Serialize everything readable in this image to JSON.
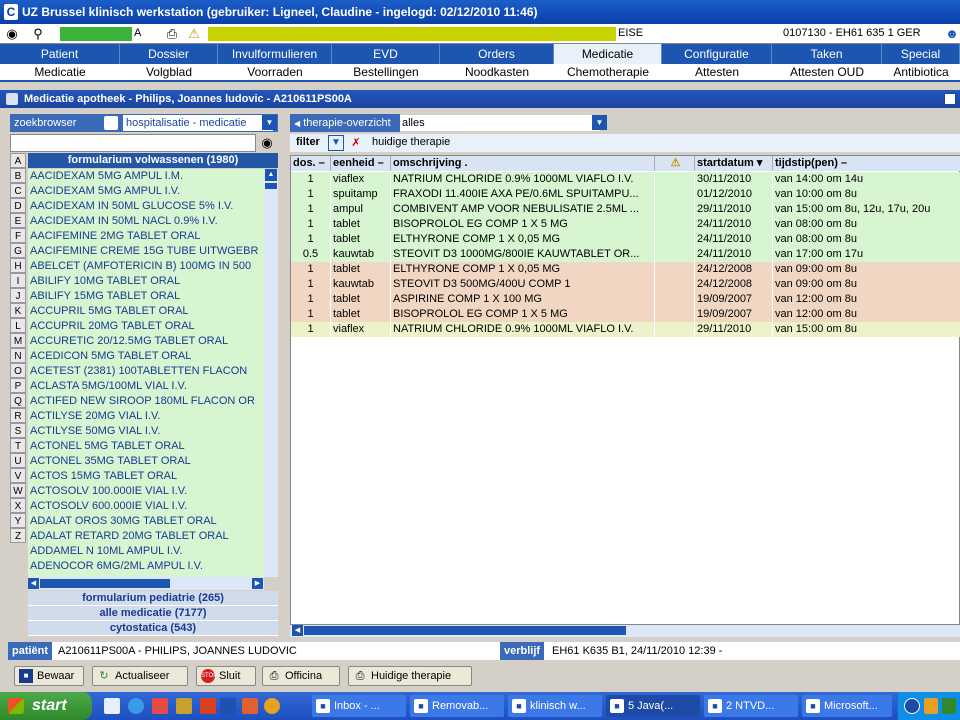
{
  "window": {
    "title": "UZ Brussel klinisch werkstation  (gebruiker:  Ligneel, Claudine - ingelogd: 02/12/2010 11:46)"
  },
  "infobar": {
    "left_frag": "A",
    "mid_frag": "EISE",
    "right_text": "0107130 - EH61 635 1 GER"
  },
  "main_tabs": [
    {
      "label": "Patient"
    },
    {
      "label": "Dossier"
    },
    {
      "label": "Invulformulieren"
    },
    {
      "label": "EVD"
    },
    {
      "label": "Orders"
    },
    {
      "label": "Medicatie"
    },
    {
      "label": "Configuratie"
    },
    {
      "label": "Taken"
    },
    {
      "label": "Special"
    }
  ],
  "sub_tabs": [
    {
      "label": "Medicatie"
    },
    {
      "label": "Volgblad"
    },
    {
      "label": "Voorraden"
    },
    {
      "label": "Bestellingen"
    },
    {
      "label": "Noodkasten"
    },
    {
      "label": "Chemotherapie"
    },
    {
      "label": "Attesten"
    },
    {
      "label": "Attesten OUD"
    },
    {
      "label": "Antibiotica"
    }
  ],
  "inner_window": {
    "title": "Medicatie apotheek - Philips, Joannes ludovic - A210611PS00A"
  },
  "left_panel": {
    "label": "zoekbrowser",
    "select_value": "hospitalisatie - medicatie",
    "alphabet": [
      "A",
      "B",
      "C",
      "D",
      "E",
      "F",
      "G",
      "H",
      "I",
      "J",
      "K",
      "L",
      "M",
      "N",
      "O",
      "P",
      "Q",
      "R",
      "S",
      "T",
      "U",
      "V",
      "W",
      "X",
      "Y",
      "Z"
    ],
    "list_header": "formularium volwassenen (1980)",
    "items": [
      "AACIDEXAM 5MG AMPUL I.M.",
      "AACIDEXAM 5MG AMPUL I.V.",
      "AACIDEXAM IN 50ML GLUCOSE 5% I.V.",
      "AACIDEXAM IN 50ML NACL 0.9% I.V.",
      "AACIFEMINE 2MG TABLET ORAL",
      "AACIFEMINE CREME 15G TUBE UITWGEBR",
      "ABELCET (AMFOTERICIN B) 100MG IN 500",
      "ABILIFY 10MG TABLET ORAL",
      "ABILIFY 15MG TABLET ORAL",
      "ACCUPRIL  5MG TABLET ORAL",
      "ACCUPRIL 20MG TABLET ORAL",
      "ACCURETIC 20/12.5MG TABLET ORAL",
      "ACEDICON 5MG TABLET ORAL",
      "ACETEST (2381) 100TABLETTEN FLACON",
      "ACLASTA 5MG/100ML VIAL I.V.",
      "ACTIFED NEW SIROOP 180ML FLACON OR",
      "ACTILYSE 20MG VIAL I.V.",
      "ACTILYSE 50MG VIAL I.V.",
      "ACTONEL  5MG TABLET ORAL",
      "ACTONEL 35MG TABLET ORAL",
      "ACTOS 15MG TABLET ORAL",
      "ACTOSOLV 100.000IE VIAL I.V.",
      "ACTOSOLV 600.000IE VIAL I.V.",
      "ADALAT OROS 30MG TABLET ORAL",
      "ADALAT RETARD 20MG TABLET ORAL",
      "ADDAMEL N 10ML AMPUL I.V.",
      "ADENOCOR 6MG/2ML AMPUL I.V."
    ],
    "categories": [
      "formularium pediatrie (265)",
      "alle medicatie (7177)",
      "cytostatica (543)"
    ]
  },
  "right_panel": {
    "label": "therapie-overzicht",
    "select_value": "alles",
    "filter_label": "filter",
    "filter_value": "huidige therapie",
    "columns": [
      "dos. –",
      "eenheid –",
      "omschrijving .",
      "",
      "startdatum ▾",
      "tijdstip(pen)  –"
    ],
    "rows": [
      {
        "dos": "1",
        "eenheid": "viaflex",
        "omschrijving": "NATRIUM CHLORIDE 0.9% 1000ML VIAFLO I.V.",
        "startdatum": "30/11/2010",
        "tijdstip": "van 14:00 om 14u",
        "bg": "#d6f5d0"
      },
      {
        "dos": "1",
        "eenheid": "spuitamp",
        "omschrijving": "FRAXODI 11.400IE AXA PE/0.6ML SPUITAMPU...",
        "startdatum": "01/12/2010",
        "tijdstip": "van 10:00 om 8u",
        "bg": "#d6f5d0"
      },
      {
        "dos": "1",
        "eenheid": "ampul",
        "omschrijving": "COMBIVENT AMP VOOR NEBULISATIE 2.5ML ...",
        "startdatum": "29/11/2010",
        "tijdstip": "van 15:00 om 8u, 12u, 17u, 20u",
        "bg": "#d6f5d0"
      },
      {
        "dos": "1",
        "eenheid": "tablet",
        "omschrijving": "BISOPROLOL EG COMP 1 X  5 MG",
        "startdatum": "24/11/2010",
        "tijdstip": "van 08:00 om 8u",
        "bg": "#d6f5d0"
      },
      {
        "dos": "1",
        "eenheid": "tablet",
        "omschrijving": "ELTHYRONE COMP   1 X 0,05 MG",
        "startdatum": "24/11/2010",
        "tijdstip": "van 08:00 om 8u",
        "bg": "#d6f5d0"
      },
      {
        "dos": "0.5",
        "eenheid": "kauwtab",
        "omschrijving": "STEOVIT D3 1000MG/800IE KAUWTABLET OR...",
        "startdatum": "24/11/2010",
        "tijdstip": "van 17:00 om 17u",
        "bg": "#d6f5d0"
      },
      {
        "dos": "1",
        "eenheid": "tablet",
        "omschrijving": "ELTHYRONE COMP   1 X 0,05 MG",
        "startdatum": "24/12/2008",
        "tijdstip": "van 09:00 om 8u",
        "bg": "#f2d6c4"
      },
      {
        "dos": "1",
        "eenheid": "kauwtab",
        "omschrijving": "STEOVIT D3 500MG/400U COMP 1",
        "startdatum": "24/12/2008",
        "tijdstip": "van 09:00 om 8u",
        "bg": "#f2d6c4"
      },
      {
        "dos": "1",
        "eenheid": "tablet",
        "omschrijving": "ASPIRINE COMP 1 X 100 MG",
        "startdatum": "19/09/2007",
        "tijdstip": "van 12:00 om 8u",
        "bg": "#f2d6c4"
      },
      {
        "dos": "1",
        "eenheid": "tablet",
        "omschrijving": "BISOPROLOL EG COMP 1 X  5 MG",
        "startdatum": "19/09/2007",
        "tijdstip": "van 12:00 om 8u",
        "bg": "#f2d6c4"
      },
      {
        "dos": "1",
        "eenheid": "viaflex",
        "omschrijving": "NATRIUM CHLORIDE 0.9% 1000ML VIAFLO I.V.",
        "startdatum": "29/11/2010",
        "tijdstip": "van 15:00 om 8u",
        "bg": "#eef2c8"
      }
    ]
  },
  "patient_bar": {
    "patient_label": "patiënt",
    "patient_value": "A210611PS00A - PHILIPS, JOANNES LUDOVIC",
    "stay_label": "verblijf",
    "stay_value": "EH61 K635 B1, 24/11/2010 12:39 -"
  },
  "buttons": {
    "save": "Bewaar",
    "refresh": "Actualiseer",
    "close": "Sluit",
    "officina": "Officina",
    "current": "Huidige therapie"
  },
  "taskbar": {
    "start": "start",
    "items": [
      "Inbox - ...",
      "Removab...",
      "klinisch w...",
      "5 Java(...",
      "2 NTVD...",
      "Microsoft..."
    ]
  },
  "colors": {
    "accent": "#1c56b0",
    "mask_yellow": "#c8d400",
    "mask_green": "#3cb43c"
  }
}
